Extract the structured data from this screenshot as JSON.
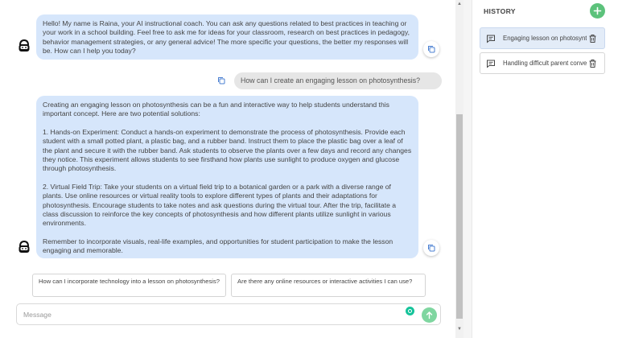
{
  "chat": {
    "greeting": "Hello! My name is Raina, your AI instructional coach. You can ask any questions related to best practices in teaching or your work in a school building. Feel free to ask me for ideas for your classroom, research on best practices in pedagogy, behavior management strategies, or any general advice! The more specific your questions, the better my responses will be. How can I help you today?",
    "user_question": "How can I create an engaging lesson on photosynthesis?",
    "response": {
      "intro": "Creating an engaging lesson on photosynthesis can be a fun and interactive way to help students understand this important concept. Here are two potential solutions:",
      "point1": "1. Hands-on Experiment: Conduct a hands-on experiment to demonstrate the process of photosynthesis. Provide each student with a small potted plant, a plastic bag, and a rubber band. Instruct them to place the plastic bag over a leaf of the plant and secure it with the rubber band. Ask students to observe the plants over a few days and record any changes they notice. This experiment allows students to see firsthand how plants use sunlight to produce oxygen and glucose through photosynthesis.",
      "point2": "2. Virtual Field Trip: Take your students on a virtual field trip to a botanical garden or a park with a diverse range of plants. Use online resources or virtual reality tools to explore different types of plants and their adaptations for photosynthesis. Encourage students to take notes and ask questions during the virtual tour. After the trip, facilitate a class discussion to reinforce the key concepts of photosynthesis and how different plants utilize sunlight in various environments.",
      "closing": "Remember to incorporate visuals, real-life examples, and opportunities for student participation to make the lesson engaging and memorable."
    },
    "suggestions": [
      "How can I incorporate technology into a lesson on photosynthesis?",
      "Are there any online resources or interactive activities I can use?"
    ],
    "input_placeholder": "Message"
  },
  "history": {
    "title": "HISTORY",
    "items": [
      {
        "label": "Engaging lesson on photosynthesis",
        "active": true
      },
      {
        "label": "Handling difficult parent conversations",
        "active": false
      }
    ]
  },
  "colors": {
    "ai_bubble": "#d6e6fb",
    "user_bubble": "#e6e6e6",
    "accent_green": "#5cc27b",
    "active_history": "#e3ecf8"
  },
  "icons": {
    "avatar": "robot-avatar-icon",
    "copy": "copy-icon",
    "send": "send-arrow-icon",
    "add": "plus-icon",
    "chat": "chat-bubble-icon",
    "delete": "trash-icon"
  }
}
